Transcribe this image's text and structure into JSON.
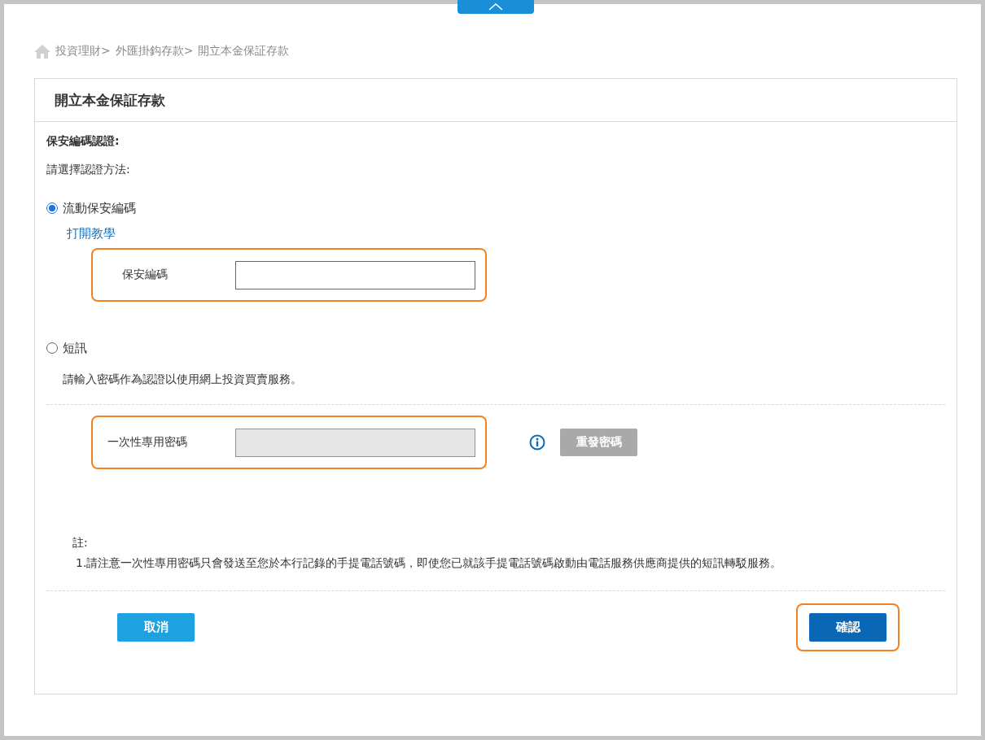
{
  "breadcrumb": [
    "投資理財>",
    "外匯掛鈎存款>",
    "開立本金保証存款"
  ],
  "card": {
    "title": "開立本金保証存款",
    "section_title": "保安編碼認證:",
    "prompt": "請選擇認證方法:",
    "options": [
      {
        "label": "流動保安編碼",
        "selected": true,
        "link": "打開教學",
        "field": {
          "label": "保安編碼",
          "highlighted": true,
          "disabled": false
        }
      },
      {
        "label": "短訊",
        "selected": false,
        "description": "請輸入密碼作為認證以使用網上投資買賣服務。",
        "field": {
          "label": "一次性專用密碼",
          "highlighted": true,
          "disabled": true
        },
        "resend_button": {
          "label": "重發密碼",
          "disabled": true
        }
      }
    ],
    "note_title": "註:",
    "notes": [
      "1.請注意一次性專用密碼只會發送至您於本行記錄的手提電話號碼，即使您已就該手提電話號碼啟動由電話服務供應商提供的短訊轉駁服務。"
    ],
    "buttons": [
      {
        "label": "取消",
        "kind": "secondary",
        "highlighted": false
      },
      {
        "label": "確認",
        "kind": "primary",
        "highlighted": true
      }
    ]
  }
}
